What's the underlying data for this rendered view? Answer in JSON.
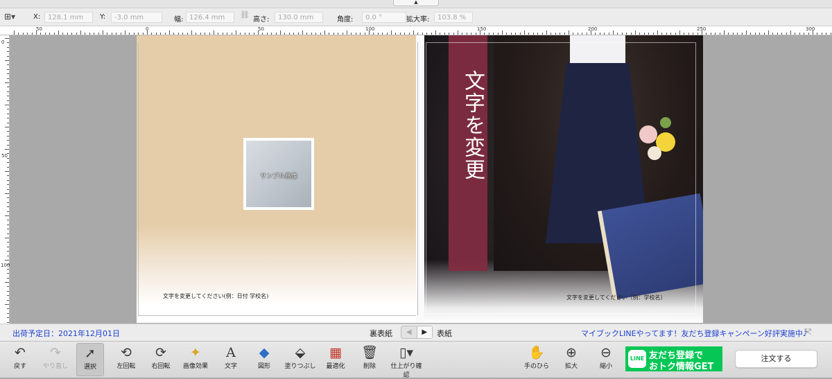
{
  "window": {
    "grabber_glyph": "▲"
  },
  "properties": {
    "x_label": "X:",
    "x_value": "128.1 mm",
    "y_label": "Y:",
    "y_value": "-3.0 mm",
    "width_label": "幅:",
    "width_value": "126.4 mm",
    "height_label": "高さ:",
    "height_value": "130.0 mm",
    "angle_label": "角度:",
    "angle_value": "0.0 °",
    "zoom_label": "拡大率:",
    "zoom_value": "103.8 %"
  },
  "ruler": {
    "h_labels": [
      "50",
      "0",
      "50",
      "100",
      "150",
      "200",
      "250",
      "300"
    ],
    "v_labels": [
      "0",
      "50",
      "100"
    ]
  },
  "back_cover": {
    "sample_image_label": "サンプル画像",
    "caption": "文字を変更してください(例：日付 学校名)"
  },
  "front_cover": {
    "title": "文字を変更",
    "caption": "文字を変更してください（例：学校名）"
  },
  "status": {
    "ship_date": "出荷予定日：2021年12月01日",
    "back_label": "裏表紙",
    "front_label": "表紙",
    "nav_prev": "◀",
    "nav_next": "▶",
    "line_banner": "マイブックLINEやってます！友だち登録キャンペーン好評実施中♪",
    "expand_glyph": "⤧"
  },
  "toolbar": {
    "undo": "戻す",
    "redo": "やり直し",
    "select": "選択",
    "rotate_left": "左回転",
    "rotate_right": "右回転",
    "image_effect": "画像効果",
    "text": "文字",
    "shape": "図形",
    "fill": "塗りつぶし",
    "optimize": "最適化",
    "delete": "削除",
    "preview": "仕上がり確認",
    "hand": "手のひら",
    "zoom_in": "拡大",
    "zoom_out": "縮小",
    "line_logo": "LINE",
    "line_ad_line1": "友だち登録で",
    "line_ad_line2": "おトク情報GET",
    "order": "注文する"
  },
  "colors": {
    "accent_blue": "#1a3fd1",
    "line_green": "#06c755",
    "title_band": "#822c42"
  }
}
